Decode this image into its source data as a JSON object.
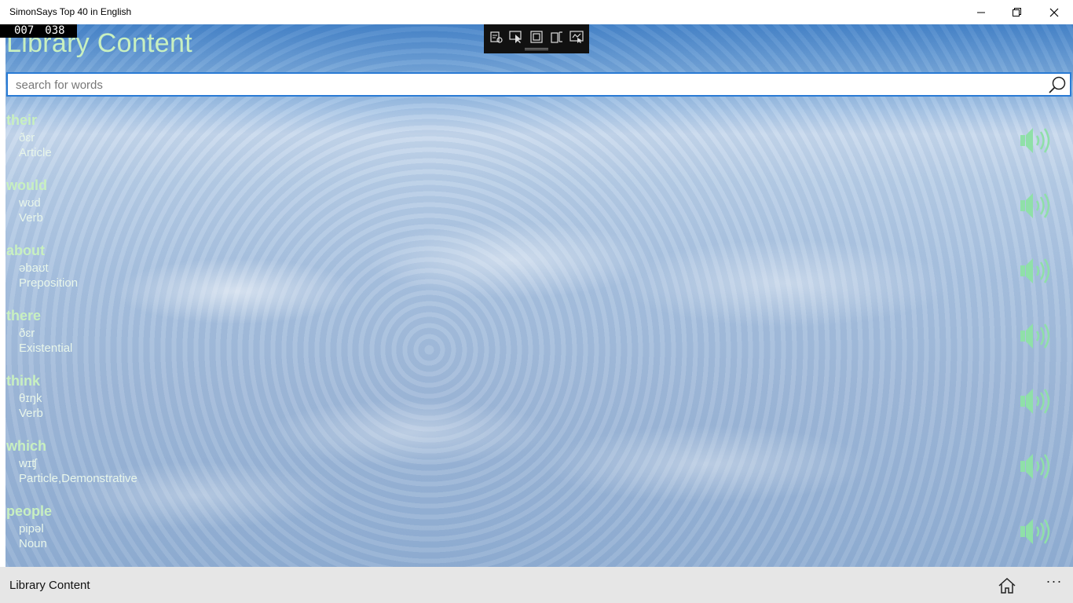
{
  "window": {
    "title": "SimonSays Top 40 in English",
    "controls": {
      "minimize": "minimize-icon",
      "maximize": "maximize-icon",
      "close": "close-icon"
    }
  },
  "counter": {
    "left": "007",
    "right": "038"
  },
  "page": {
    "title": "Library Content"
  },
  "dev_toolbar": {
    "icons": [
      "live-visual-tree-icon",
      "select-element-icon",
      "display-layout-adorners-icon",
      "track-focused-element-icon",
      "hot-reload-icon"
    ]
  },
  "search": {
    "placeholder": "search for words",
    "value": "",
    "icon": "search-icon"
  },
  "words": [
    {
      "word": "their",
      "ipa": "ðɛr",
      "pos": "Article"
    },
    {
      "word": "would",
      "ipa": "wʊd",
      "pos": "Verb"
    },
    {
      "word": "about",
      "ipa": "əbaʊt",
      "pos": "Preposition"
    },
    {
      "word": "there",
      "ipa": "ðɛr",
      "pos": "Existential"
    },
    {
      "word": "think",
      "ipa": "θɪŋk",
      "pos": "Verb"
    },
    {
      "word": "which",
      "ipa": "wɪʧ",
      "pos": "Particle,Demonstrative"
    },
    {
      "word": "people",
      "ipa": "pipəl",
      "pos": "Noun"
    }
  ],
  "appbar": {
    "title": "Library Content",
    "more": "···"
  },
  "colors": {
    "accent": "#2a7bd4",
    "word_green": "#c8f0c0",
    "speaker_green": "#8fe0a8"
  }
}
